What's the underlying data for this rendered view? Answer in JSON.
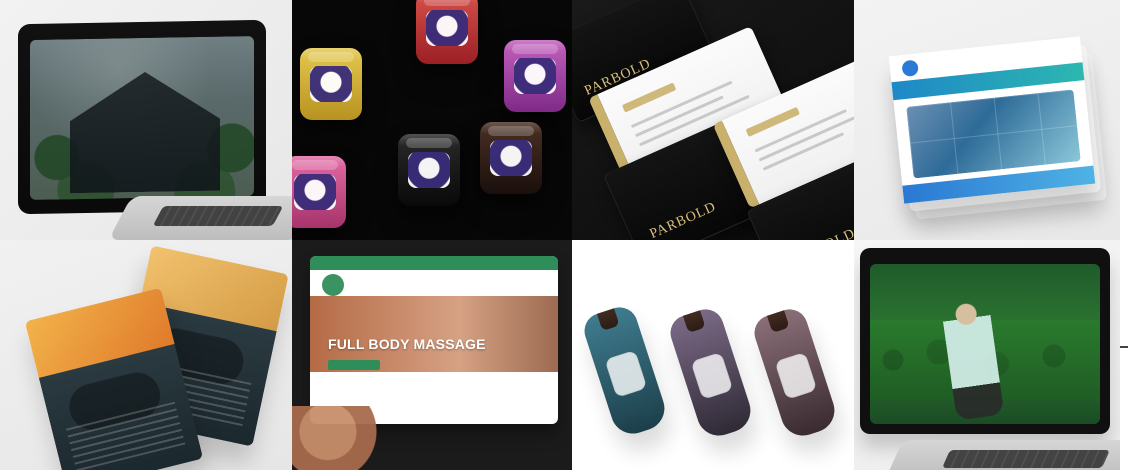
{
  "brand": {
    "parbold_text": "PARBOLD"
  },
  "website": {
    "hero_title": "FULL BODY MASSAGE"
  },
  "tiles": [
    {
      "name": "laptop-mockup-house-photo",
      "label": "Laptop mockup"
    },
    {
      "name": "candle-tins-packaging",
      "label": "Candle tins"
    },
    {
      "name": "parbold-business-cards",
      "label": "Business cards"
    },
    {
      "name": "brochure-stack",
      "label": "Brochure"
    },
    {
      "name": "flyer-mockups",
      "label": "Flyers"
    },
    {
      "name": "massage-website-on-laptop",
      "label": "Website"
    },
    {
      "name": "bottle-packaging",
      "label": "Bottles"
    },
    {
      "name": "laptop-mockup-green-scene",
      "label": "Laptop mockup"
    }
  ]
}
